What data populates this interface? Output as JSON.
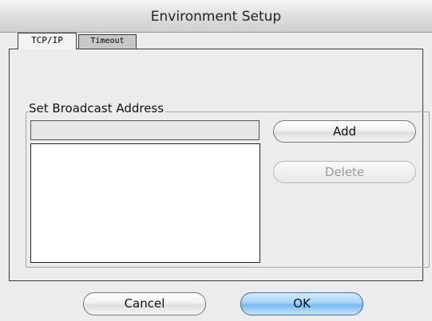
{
  "window": {
    "title": "Environment Setup"
  },
  "tabs": [
    {
      "label": "TCP/IP",
      "active": true
    },
    {
      "label": "Timeout",
      "active": false
    }
  ],
  "broadcast": {
    "group_label": "Set Broadcast Address",
    "address_value": "",
    "list_items": [],
    "add_label": "Add",
    "delete_label": "Delete",
    "delete_enabled": false
  },
  "footer": {
    "cancel_label": "Cancel",
    "ok_label": "OK"
  },
  "colors": {
    "default_button": "#7ab9ef",
    "disabled_text": "#9a9a9a"
  }
}
